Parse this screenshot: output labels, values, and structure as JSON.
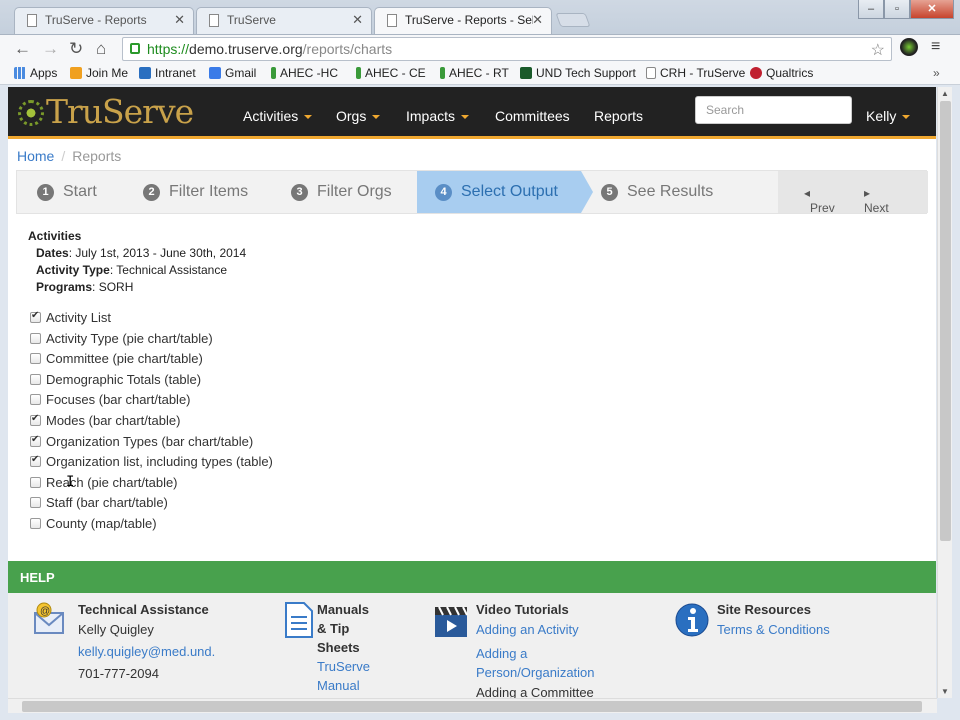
{
  "browser": {
    "tabs": [
      {
        "label": "TruServe - Reports",
        "active": false
      },
      {
        "label": "TruServe",
        "active": false
      },
      {
        "label": "TruServe - Reports - Select",
        "active": true
      }
    ],
    "url_scheme": "https://",
    "url_host": "demo.truserve.org",
    "url_path": "/reports/charts",
    "bookmarks": [
      {
        "label": "Apps",
        "icon": "apps-grid-icon",
        "color": "#4a8be0"
      },
      {
        "label": "Join Me",
        "icon": "joinme-icon",
        "color": "#f0a020"
      },
      {
        "label": "Intranet",
        "icon": "sharepoint-icon",
        "color": "#2a6fc0"
      },
      {
        "label": "Gmail",
        "icon": "google-icon",
        "color": "#3a7be8"
      },
      {
        "label": "AHEC -HC",
        "icon": "ahec-icon",
        "color": "#3a9a3a"
      },
      {
        "label": "AHEC - CE",
        "icon": "ahec-icon",
        "color": "#3a9a3a"
      },
      {
        "label": "AHEC - RT",
        "icon": "ahec-icon",
        "color": "#3a9a3a"
      },
      {
        "label": "UND Tech Support",
        "icon": "und-icon",
        "color": "#1a5a2a"
      },
      {
        "label": "CRH - TruServe",
        "icon": "page-icon",
        "color": "#ffffff"
      },
      {
        "label": "Qualtrics",
        "icon": "qualtrics-icon",
        "color": "#c02030"
      }
    ]
  },
  "site": {
    "logo": "TruServe",
    "nav": [
      {
        "label": "Activities",
        "dropdown": true
      },
      {
        "label": "Orgs",
        "dropdown": true
      },
      {
        "label": "Impacts",
        "dropdown": true
      },
      {
        "label": "Committees",
        "dropdown": false
      },
      {
        "label": "Reports",
        "dropdown": false
      }
    ],
    "search_placeholder": "Search",
    "user": "Kelly",
    "accent": "#f0a830"
  },
  "breadcrumb": {
    "home": "Home",
    "current": "Reports"
  },
  "wizard": {
    "steps": [
      {
        "num": "1",
        "label": "Start"
      },
      {
        "num": "2",
        "label": "Filter Items"
      },
      {
        "num": "3",
        "label": "Filter Orgs"
      },
      {
        "num": "4",
        "label": "Select Output",
        "active": true
      },
      {
        "num": "5",
        "label": "See Results"
      }
    ],
    "prev": "Prev",
    "next": "Next"
  },
  "summary": {
    "heading": "Activities",
    "dates_label": "Dates",
    "dates_value": ": July 1st, 2013 - June 30th, 2014",
    "type_label": "Activity Type",
    "type_value": ": Technical Assistance",
    "programs_label": "Programs",
    "programs_value": ": SORH"
  },
  "options": [
    {
      "label": "Activity List",
      "checked": true
    },
    {
      "label": "Activity Type (pie chart/table)",
      "checked": false
    },
    {
      "label": "Committee (pie chart/table)",
      "checked": false
    },
    {
      "label": "Demographic Totals (table)",
      "checked": false
    },
    {
      "label": "Focuses (bar chart/table)",
      "checked": false
    },
    {
      "label": "Modes (bar chart/table)",
      "checked": true
    },
    {
      "label": "Organization Types (bar chart/table)",
      "checked": true
    },
    {
      "label": "Organization list, including types (table)",
      "checked": true
    },
    {
      "label": "Reach (pie chart/table)",
      "checked": false
    },
    {
      "label": "Staff (bar chart/table)",
      "checked": false
    },
    {
      "label": "County (map/table)",
      "checked": false
    }
  ],
  "help": {
    "title": "HELP",
    "color": "#48a14d",
    "tech": {
      "title": "Technical Assistance",
      "name": "Kelly Quigley",
      "email": "kelly.quigley@med.und.",
      "phone": "701-777-2094"
    },
    "manuals": {
      "title_1": "Manuals",
      "title_2": "& Tip",
      "title_3": "Sheets",
      "link_1": "TruServe",
      "link_2": "Manual"
    },
    "videos": {
      "title": "Video Tutorials",
      "link_1": "Adding an Activity",
      "link_2a": "Adding a",
      "link_2b": "Person/Organization",
      "link_3": "Adding a Committee"
    },
    "site": {
      "title": "Site Resources",
      "link_1": "Terms & Conditions"
    }
  }
}
